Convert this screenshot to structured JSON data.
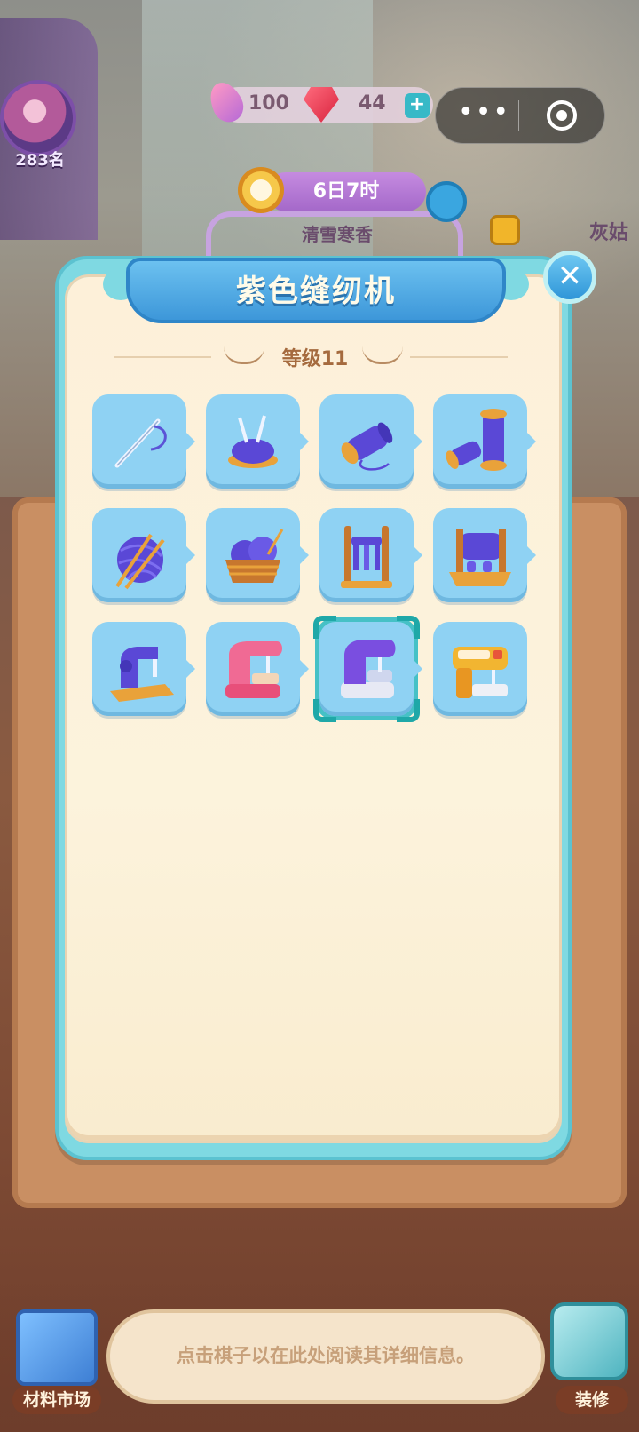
{
  "hud": {
    "rank": "283名",
    "resource_feather_value": "100",
    "resource_gem_value": "44",
    "plus_symbol": "+",
    "capsule_more": "•••"
  },
  "event": {
    "timer": "6日7时",
    "name": "清雪寒香",
    "right_card_title": "灰姑"
  },
  "modal": {
    "title": "紫色缝纫机",
    "level_label": "等级11",
    "close_symbol": "✕",
    "items": [
      {
        "icon": "sewing-needle-icon"
      },
      {
        "icon": "pincushion-icon"
      },
      {
        "icon": "thread-spool-icon"
      },
      {
        "icon": "double-spool-icon"
      },
      {
        "icon": "yarn-ball-icon"
      },
      {
        "icon": "yarn-basket-icon"
      },
      {
        "icon": "spool-rack-icon"
      },
      {
        "icon": "thread-winder-icon"
      },
      {
        "icon": "hand-sewing-machine-icon"
      },
      {
        "icon": "pink-sewing-machine-icon"
      },
      {
        "icon": "purple-sewing-machine-icon",
        "selected": true
      },
      {
        "icon": "industrial-sewing-machine-icon"
      }
    ]
  },
  "bottom": {
    "info_text": "点击棋子以在此处阅读其详细信息。",
    "market_label": "材料市场",
    "decor_label": "装修"
  },
  "colors": {
    "modal_frame": "#7fd9e2",
    "tile_bg": "#8fd2f3",
    "ribbon": "#3d97d9",
    "selection": "#1fa8a8"
  }
}
